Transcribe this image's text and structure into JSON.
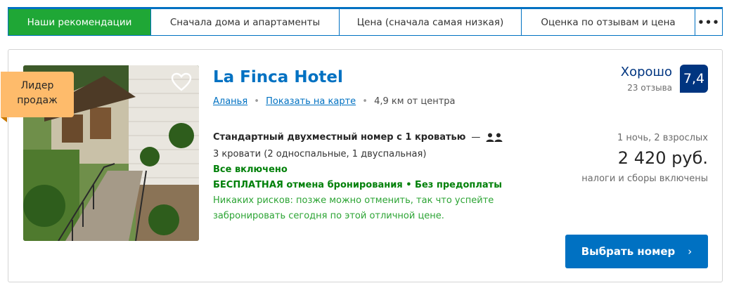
{
  "sort_tabs": [
    {
      "label": "Наши рекомендации",
      "active": true
    },
    {
      "label": "Сначала дома и апартаменты",
      "active": false
    },
    {
      "label": "Цена (сначала самая низкая)",
      "active": false
    },
    {
      "label": "Оценка по отзывам и цена",
      "active": false
    }
  ],
  "sort_more": "•••",
  "hotel": {
    "badge": {
      "line1": "Лидер",
      "line2": "продаж"
    },
    "name": "La Finca Hotel",
    "city_link": "Аланья",
    "map_link": "Показать на карте",
    "distance": "4,9 км от центра",
    "rating_word": "Хорошо",
    "review_count": "23 отзыва",
    "score": "7,4",
    "room_name": "Стандартный двухместный номер с 1 кроватью",
    "room_dash": "—",
    "beds": "3 кровати (2 односпальные, 1 двуспальная)",
    "meal": "Все включено",
    "cancellation": "БЕСПЛАТНАЯ отмена бронирования • Без предоплаты",
    "reassurance": "Никаких рисков: позже можно отменить, так что успейте забронировать сегодня по этой отличной цене.",
    "stay": "1 ночь, 2 взрослых",
    "price": "2 420 руб.",
    "taxes": "налоги и сборы включены",
    "cta_label": "Выбрать номер",
    "cta_chevron": "›"
  },
  "colors": {
    "accent_blue": "#0071c2",
    "active_tab_green": "#1fa736",
    "score_navy": "#003580",
    "deal_green": "#008009",
    "badge_orange": "#febb6b"
  },
  "icons": [
    "heart-icon",
    "guests-icon",
    "chevron-right-icon",
    "more-dots-icon"
  ]
}
